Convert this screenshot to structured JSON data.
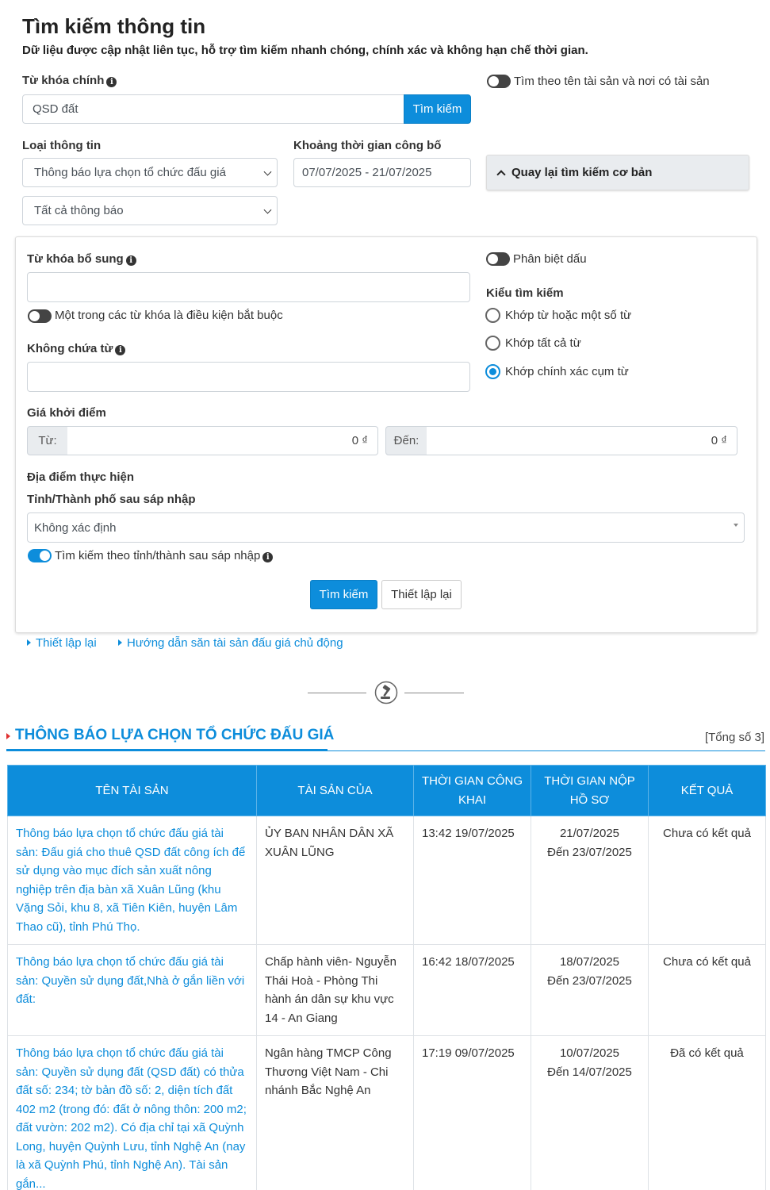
{
  "header": {
    "title": "Tìm kiếm thông tin",
    "subtitle": "Dữ liệu được cập nhật liên tục, hỗ trợ tìm kiếm nhanh chóng, chính xác và không hạn chế thời gian."
  },
  "search": {
    "keyword_label": "Từ khóa chính",
    "keyword_value": "QSD đất",
    "search_button": "Tìm kiếm",
    "asset_toggle_label": "Tìm theo tên tài sản và nơi có tài sản"
  },
  "filters": {
    "type_label": "Loại thông tin",
    "type_value": "Thông báo lựa chọn tổ chức đấu giá",
    "notice_value": "Tất cả thông báo",
    "period_label": "Khoảng thời gian công bố",
    "period_value": "07/07/2025 - 21/07/2025",
    "back_basic_label": "Quay lại tìm kiếm cơ bản"
  },
  "advanced": {
    "extra_keyword_label": "Từ khóa bổ sung",
    "one_required_label": "Một trong các từ khóa là điều kiện bắt buộc",
    "exclude_label": "Không chứa từ",
    "accent_toggle_label": "Phân biệt dấu",
    "search_type_label": "Kiểu tìm kiếm",
    "search_type_options": [
      "Khớp từ hoặc một số từ",
      "Khớp tất cả từ",
      "Khớp chính xác cụm từ"
    ],
    "search_type_selected": 2,
    "price_label": "Giá khởi điểm",
    "price_from_label": "Từ:",
    "price_from_value": "0 ₫",
    "price_to_label": "Đến:",
    "price_to_value": "0 ₫",
    "location_label": "Địa điểm thực hiện",
    "province_label": "Tỉnh/Thành phố sau sáp nhập",
    "province_value": "Không xác định",
    "province_toggle_label": "Tìm kiếm theo tỉnh/thành sau sáp nhập",
    "submit_label": "Tìm kiếm",
    "reset_label": "Thiết lập lại"
  },
  "links": {
    "reset": "Thiết lập lại",
    "guide": "Hướng dẫn săn tài sản đấu giá chủ động"
  },
  "results": {
    "title": "THÔNG BÁO LỰA CHỌN TỔ CHỨC ĐẤU GIÁ",
    "total": "[Tổng số 3]",
    "columns": [
      "TÊN TÀI SẢN",
      "TÀI SẢN CỦA",
      "THỜI GIAN CÔNG KHAI",
      "THỜI GIAN NỘP HỒ SƠ",
      "KẾT QUẢ"
    ],
    "rows": [
      {
        "name": "Thông báo lựa chọn tổ chức đấu giá tài sản: Đấu giá cho thuê QSD đất công ích để sử dụng vào mục đích sản xuất nông nghiệp trên địa bàn xã Xuân Lũng (khu Vặng Sỏi, khu 8, xã Tiên Kiên, huyện Lâm Thao cũ), tỉnh Phú Thọ.",
        "owner": "ỦY BAN NHÂN DÂN XÃ XUÂN LŨNG",
        "public_time": "13:42 19/07/2025",
        "submit_from": "21/07/2025",
        "submit_to": "Đến 23/07/2025",
        "result": "Chưa có kết quả"
      },
      {
        "name": "Thông báo lựa chọn tổ chức đấu giá tài sản: Quyền sử dụng đất,Nhà ở gắn liền với đất:",
        "owner": "Chấp hành viên- Nguyễn Thái Hoà - Phòng Thi hành án dân sự khu vực 14 - An Giang",
        "public_time": "16:42 18/07/2025",
        "submit_from": "18/07/2025",
        "submit_to": "Đến 23/07/2025",
        "result": "Chưa có kết quả"
      },
      {
        "name": "Thông báo lựa chọn tổ chức đấu giá tài sản: Quyền sử dụng đất (QSD đất) có thửa đất số: 234; tờ bản đồ số: 2, diện tích đất 402 m2 (trong đó: đất ở nông thôn: 200 m2; đất vườn: 202 m2). Có địa chỉ tại xã Quỳnh Long, huyện Quỳnh Lưu, tỉnh Nghệ An (nay là xã Quỳnh Phú, tỉnh Nghệ An). Tài sản gắn...",
        "owner": "Ngân hàng TMCP Công Thương Việt Nam - Chi nhánh Bắc Nghệ An",
        "public_time": "17:19 09/07/2025",
        "submit_from": "10/07/2025",
        "submit_to": "Đến 14/07/2025",
        "result": "Đã có kết quả"
      }
    ]
  }
}
